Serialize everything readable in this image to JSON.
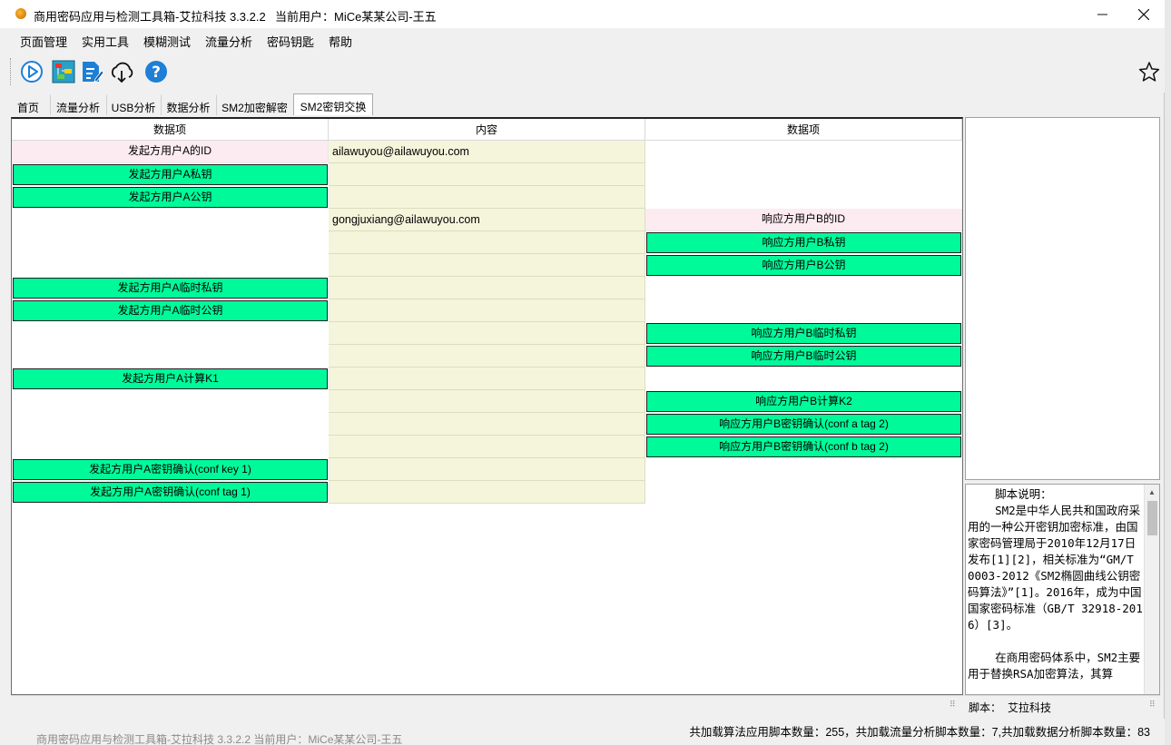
{
  "window": {
    "title": "商用密码应用与检测工具箱-艾拉科技 3.3.2.2",
    "current_user": "当前用户：MiCe某某公司-王五"
  },
  "menu": [
    "页面管理",
    "实用工具",
    "模糊测试",
    "流量分析",
    "密码钥匙",
    "帮助"
  ],
  "toolbar": {
    "icons": [
      "play-icon",
      "network-icon",
      "edit-doc-icon",
      "cloud-download-icon",
      "help-icon",
      "star-icon"
    ]
  },
  "tabs": [
    "首页",
    "流量分析",
    "USB分析",
    "数据分析",
    "SM2加密解密",
    "SM2密钥交换"
  ],
  "active_tab": "SM2密钥交换",
  "grid": {
    "headers": [
      "数据项",
      "内容",
      "数据项"
    ],
    "rows": [
      {
        "left": "发起方用户A的ID",
        "left_style": "pink",
        "content": "ailawuyou@ailawuyou.com",
        "right": "",
        "right_style": "none"
      },
      {
        "left": "发起方用户A私钥",
        "left_style": "green",
        "content": "",
        "right": "",
        "right_style": "none"
      },
      {
        "left": "发起方用户A公钥",
        "left_style": "green",
        "content": "",
        "right": "",
        "right_style": "none"
      },
      {
        "left": "",
        "left_style": "none",
        "content": "gongjuxiang@ailawuyou.com",
        "right": "响应方用户B的ID",
        "right_style": "pink"
      },
      {
        "left": "",
        "left_style": "none",
        "content": "",
        "right": "响应方用户B私钥",
        "right_style": "green"
      },
      {
        "left": "",
        "left_style": "none",
        "content": "",
        "right": "响应方用户B公钥",
        "right_style": "green"
      },
      {
        "left": "发起方用户A临时私钥",
        "left_style": "green",
        "content": "",
        "right": "",
        "right_style": "none"
      },
      {
        "left": "发起方用户A临时公钥",
        "left_style": "green",
        "content": "",
        "right": "",
        "right_style": "none"
      },
      {
        "left": "",
        "left_style": "none",
        "content": "",
        "right": "响应方用户B临时私钥",
        "right_style": "green"
      },
      {
        "left": "",
        "left_style": "none",
        "content": "",
        "right": "响应方用户B临时公钥",
        "right_style": "green"
      },
      {
        "left": "发起方用户A计算K1",
        "left_style": "green",
        "content": "",
        "right": "",
        "right_style": "none"
      },
      {
        "left": "",
        "left_style": "none",
        "content": "",
        "right": "响应方用户B计算K2",
        "right_style": "green"
      },
      {
        "left": "",
        "left_style": "none",
        "content": "",
        "right": "响应方用户B密钥确认(conf a tag 2)",
        "right_style": "green"
      },
      {
        "left": "",
        "left_style": "none",
        "content": "",
        "right": "响应方用户B密钥确认(conf b tag 2)",
        "right_style": "green"
      },
      {
        "left": "发起方用户A密钥确认(conf key 1)",
        "left_style": "green",
        "content": "",
        "right": "",
        "right_style": "none"
      },
      {
        "left": "发起方用户A密钥确认(conf tag 1)",
        "left_style": "green",
        "content": "",
        "right": "",
        "right_style": "none"
      }
    ]
  },
  "description": {
    "text": "    脚本说明：\n    SM2是中华人民共和国政府采用的一种公开密钥加密标准，由国家密码管理局于2010年12月17日发布[1][2]，相关标准为“GM/T 0003-2012《SM2椭圆曲线公钥密码算法》”[1]。2016年，成为中国国家密码标准（GB/T 32918-2016）[3]。\n\n    在商用密码体系中，SM2主要用于替换RSA加密算法，其算"
  },
  "status": {
    "script_label": "脚本：",
    "script_value": "艾拉科技",
    "counts": "共加载算法应用脚本数量：255，共加载流量分析脚本数量：7,共加载数据分析脚本数量：83",
    "taskbar_ghost": "商用密码应用与检测工具箱-艾拉科技 3.3.2.2      当前用户：MiCe某某公司-王五"
  },
  "colors": {
    "green_cell": "#00FA9A",
    "pink_cell": "#FCEBF1",
    "content_cell": "#F5F5DC",
    "accent_blue": "#1e7fd6"
  }
}
